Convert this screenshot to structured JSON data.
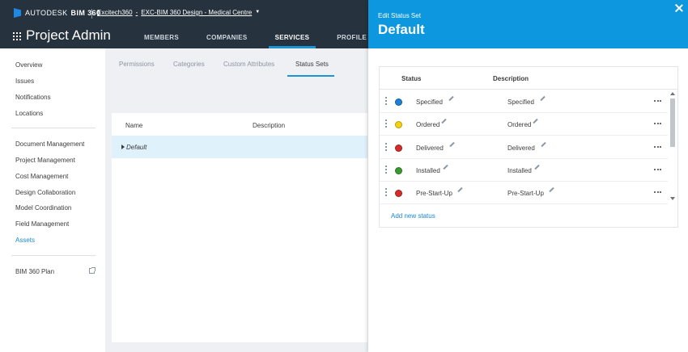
{
  "header": {
    "brand": "AUTODESK",
    "product": "BIM 360",
    "breadcrumb": {
      "account": "Excitech360",
      "separator": "-",
      "project": "EXC-BIM 360 Design - Medical Centre",
      "dropdown_icon": "chevron-down-icon"
    },
    "title": "Project Admin",
    "nav": [
      {
        "label": "MEMBERS",
        "active": false
      },
      {
        "label": "COMPANIES",
        "active": false
      },
      {
        "label": "SERVICES",
        "active": true
      },
      {
        "label": "PROFILE",
        "active": false
      }
    ]
  },
  "sidebar": {
    "group1": [
      "Overview",
      "Issues",
      "Notifications",
      "Locations"
    ],
    "group2": [
      "Document Management",
      "Project Management",
      "Cost Management",
      "Design Collaboration",
      "Model Coordination",
      "Field Management",
      "Assets"
    ],
    "active": "Assets",
    "group3": [
      "BIM 360 Plan"
    ]
  },
  "main": {
    "tabs": [
      {
        "label": "Permissions",
        "active": false
      },
      {
        "label": "Categories",
        "active": false
      },
      {
        "label": "Custom Attributes",
        "active": false
      },
      {
        "label": "Status Sets",
        "active": true
      }
    ],
    "table": {
      "columns": [
        "Name",
        "Description"
      ],
      "rows": [
        {
          "name": "Default",
          "description": ""
        }
      ]
    }
  },
  "panel": {
    "subtitle": "Edit Status Set",
    "title": "Default",
    "columns": [
      "Status",
      "Description"
    ],
    "statuses": [
      {
        "name": "Specified",
        "description": "Specified",
        "color": "#1e7fd4"
      },
      {
        "name": "Ordered",
        "description": "Ordered",
        "color": "#f5d20f"
      },
      {
        "name": "Delivered",
        "description": "Delivered",
        "color": "#d42b2b"
      },
      {
        "name": "Installed",
        "description": "Installed",
        "color": "#3a9a2f"
      },
      {
        "name": "Pre-Start-Up",
        "description": "Pre-Start-Up",
        "color": "#d42b2b"
      }
    ],
    "add_label": "Add new status"
  },
  "colors": {
    "topbar": "#26323e",
    "accent": "#1b94d6",
    "panel_header": "#0c97de",
    "link": "#1a87d2"
  }
}
